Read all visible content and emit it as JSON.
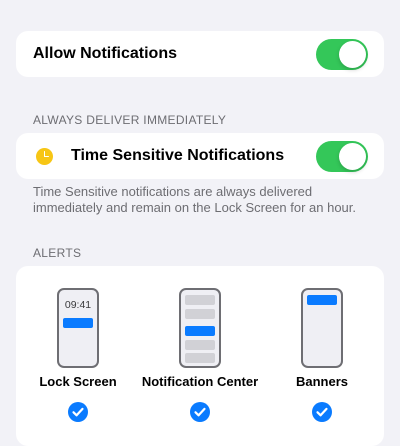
{
  "allow_notifications": {
    "label": "Allow Notifications",
    "enabled": true
  },
  "always_deliver": {
    "header": "ALWAYS DELIVER IMMEDIATELY",
    "time_sensitive_label": "Time Sensitive Notifications",
    "time_sensitive_enabled": true,
    "footer": "Time Sensitive notifications are always delivered immediately and remain on the Lock Screen for an hour."
  },
  "alerts": {
    "header": "ALERTS",
    "options": [
      {
        "label": "Lock Screen",
        "clock": "09:41",
        "selected": true,
        "icon": "lock-screen-phone-icon"
      },
      {
        "label": "Notification Center",
        "selected": true,
        "icon": "notification-center-phone-icon"
      },
      {
        "label": "Banners",
        "selected": true,
        "icon": "banners-phone-icon"
      }
    ]
  },
  "colors": {
    "toggle_on": "#34c759",
    "accent": "#0a7bff",
    "clock_icon": "#f7c615"
  }
}
